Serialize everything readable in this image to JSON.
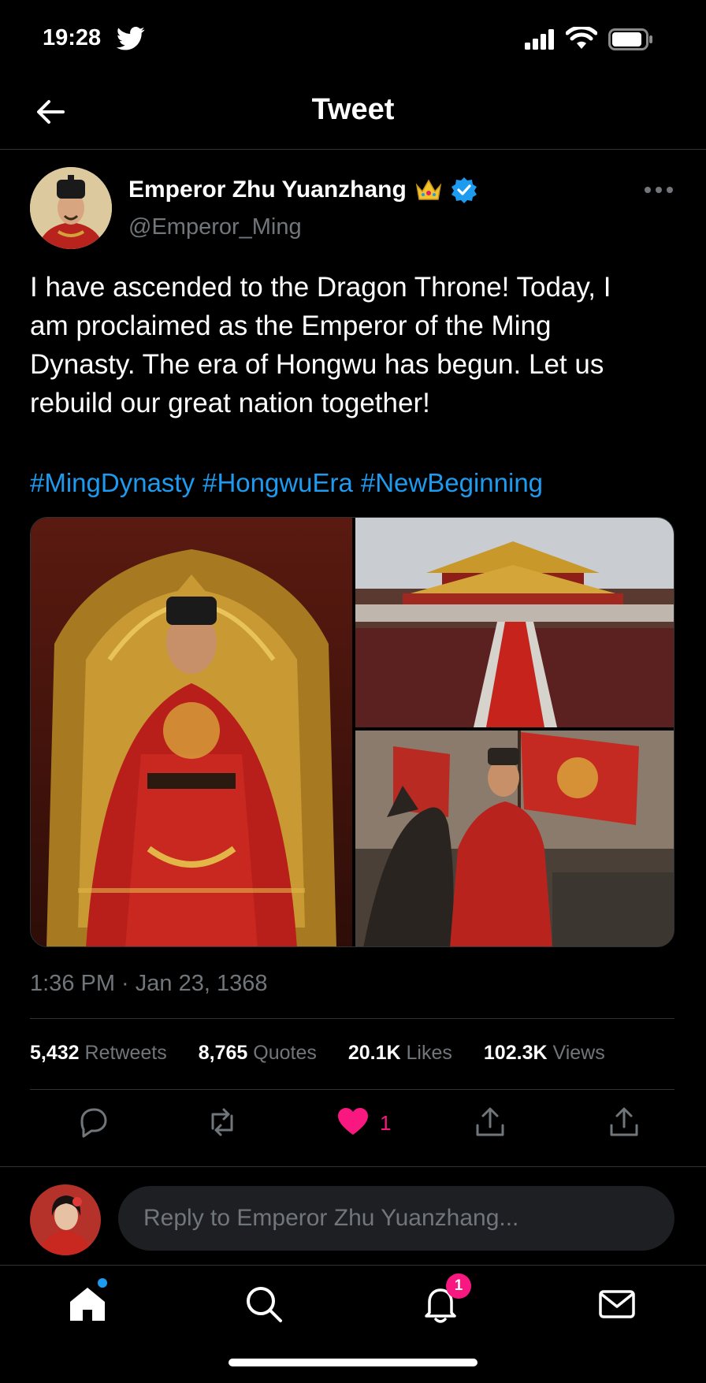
{
  "status_bar": {
    "time": "19:28"
  },
  "header": {
    "title": "Tweet"
  },
  "author": {
    "name": "Emperor Zhu Yuanzhang",
    "handle": "@Emperor_Ming",
    "name_emoji": "crown"
  },
  "tweet": {
    "text": "I have ascended to the Dragon Throne! Today, I am proclaimed as the Emperor of the Ming Dynasty. The era of Hongwu has begun. Let us rebuild our great nation together!",
    "hashtags": [
      "#MingDynasty",
      "#HongwuEra",
      "#NewBeginning"
    ],
    "timestamp": "1:36 PM · Jan 23, 1368"
  },
  "stats": [
    {
      "value": "5,432",
      "label": "Retweets"
    },
    {
      "value": "8,765",
      "label": "Quotes"
    },
    {
      "value": "20.1K",
      "label": "Likes"
    },
    {
      "value": "102.3K",
      "label": "Views"
    }
  ],
  "actions": {
    "like_count": "1"
  },
  "reply": {
    "placeholder": "Reply to Emperor Zhu Yuanzhang..."
  },
  "tabbar": {
    "notifications_badge": "1"
  },
  "colors": {
    "accent": "#1d9bf0",
    "like": "#f91880",
    "background": "#000000",
    "muted": "#71767b"
  }
}
